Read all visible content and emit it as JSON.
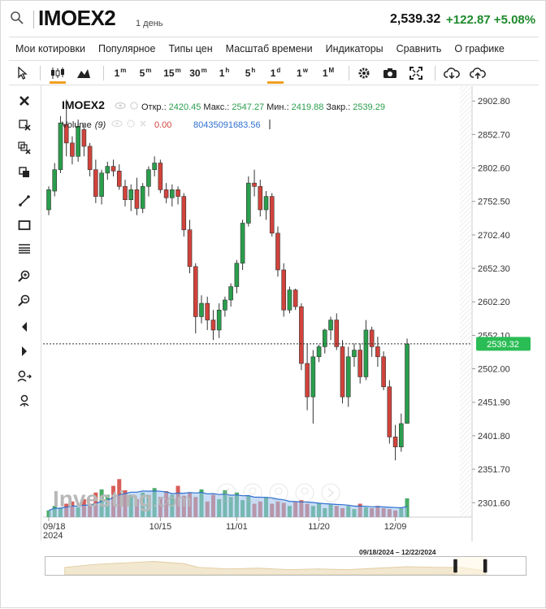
{
  "header": {
    "symbol": "IMOEX2",
    "interval": "1 день",
    "price": "2,539.32",
    "change": "+122.87 +5.08%"
  },
  "menu": [
    "Мои котировки",
    "Популярное",
    "Типы цен",
    "Масштаб времени",
    "Индикаторы",
    "Сравнить",
    "О графике"
  ],
  "toolbar": {
    "timeframes": [
      {
        "n": "1",
        "u": "m"
      },
      {
        "n": "5",
        "u": "m"
      },
      {
        "n": "15",
        "u": "m"
      },
      {
        "n": "30",
        "u": "m"
      },
      {
        "n": "1",
        "u": "h"
      },
      {
        "n": "5",
        "u": "h"
      },
      {
        "n": "1",
        "u": "d"
      },
      {
        "n": "1",
        "u": "w"
      },
      {
        "n": "1",
        "u": "M"
      }
    ],
    "active_timeframe": "1d"
  },
  "legend": {
    "symbol": "IMOEX2",
    "open_label": "Откр.:",
    "open": "2420.45",
    "high_label": "Макс.:",
    "high": "2547.27",
    "low_label": "Мин.:",
    "low": "2419.88",
    "close_label": "Закр.:",
    "close": "2539.29",
    "volume_label": "Volume",
    "volume_param": "(9)",
    "volume_value": "0.00",
    "volume_ma": "80435091683.56"
  },
  "watermark": {
    "brand": "Investing",
    "suffix": ".com"
  },
  "colors": {
    "up": "#2a9e4c",
    "down": "#d1433b",
    "volume_ma": "#2f6fcf",
    "last_price_bg": "#2bbd55"
  },
  "chart_data": {
    "type": "candlestick",
    "y_ticks": [
      "2902.80",
      "2852.70",
      "2802.60",
      "2752.50",
      "2702.40",
      "2652.30",
      "2602.20",
      "2552.10",
      "2502.00",
      "2451.90",
      "2401.80",
      "2351.70",
      "2301.60"
    ],
    "ylim": [
      2280,
      2925
    ],
    "x_ticks": [
      {
        "label": "09/18",
        "sub": "2024",
        "index": 0
      },
      {
        "label": "10/15",
        "sub": "",
        "index": 19
      },
      {
        "label": "11/01",
        "sub": "",
        "index": 32
      },
      {
        "label": "11/20",
        "sub": "",
        "index": 46
      },
      {
        "label": "12/09",
        "sub": "",
        "index": 59
      }
    ],
    "last_price": "2539.32",
    "last_value": 2539.32,
    "candles": [
      [
        2740,
        2775,
        2732,
        2770
      ],
      [
        2768,
        2810,
        2760,
        2800
      ],
      [
        2800,
        2880,
        2795,
        2870
      ],
      [
        2868,
        2905,
        2820,
        2840
      ],
      [
        2840,
        2850,
        2808,
        2820
      ],
      [
        2820,
        2875,
        2812,
        2865
      ],
      [
        2860,
        2868,
        2820,
        2835
      ],
      [
        2835,
        2840,
        2790,
        2800
      ],
      [
        2800,
        2815,
        2750,
        2760
      ],
      [
        2760,
        2800,
        2748,
        2795
      ],
      [
        2795,
        2812,
        2785,
        2805
      ],
      [
        2805,
        2815,
        2790,
        2798
      ],
      [
        2798,
        2808,
        2770,
        2775
      ],
      [
        2775,
        2785,
        2745,
        2755
      ],
      [
        2755,
        2778,
        2738,
        2770
      ],
      [
        2770,
        2788,
        2732,
        2742
      ],
      [
        2742,
        2780,
        2735,
        2775
      ],
      [
        2775,
        2805,
        2760,
        2800
      ],
      [
        2800,
        2820,
        2790,
        2810
      ],
      [
        2810,
        2815,
        2765,
        2770
      ],
      [
        2770,
        2780,
        2750,
        2758
      ],
      [
        2758,
        2778,
        2745,
        2770
      ],
      [
        2770,
        2775,
        2748,
        2760
      ],
      [
        2760,
        2765,
        2700,
        2710
      ],
      [
        2710,
        2725,
        2645,
        2655
      ],
      [
        2655,
        2660,
        2555,
        2580
      ],
      [
        2580,
        2612,
        2570,
        2600
      ],
      [
        2600,
        2610,
        2560,
        2575
      ],
      [
        2575,
        2590,
        2545,
        2560
      ],
      [
        2560,
        2600,
        2548,
        2590
      ],
      [
        2590,
        2610,
        2580,
        2605
      ],
      [
        2605,
        2630,
        2595,
        2625
      ],
      [
        2625,
        2665,
        2615,
        2660
      ],
      [
        2660,
        2725,
        2650,
        2720
      ],
      [
        2720,
        2790,
        2715,
        2780
      ],
      [
        2780,
        2800,
        2760,
        2775
      ],
      [
        2775,
        2785,
        2730,
        2740
      ],
      [
        2740,
        2768,
        2725,
        2760
      ],
      [
        2760,
        2765,
        2700,
        2705
      ],
      [
        2705,
        2715,
        2640,
        2650
      ],
      [
        2650,
        2660,
        2580,
        2590
      ],
      [
        2590,
        2625,
        2585,
        2620
      ],
      [
        2620,
        2622,
        2590,
        2595
      ],
      [
        2595,
        2600,
        2500,
        2510
      ],
      [
        2510,
        2540,
        2440,
        2460
      ],
      [
        2460,
        2530,
        2420,
        2520
      ],
      [
        2520,
        2538,
        2512,
        2535
      ],
      [
        2535,
        2562,
        2525,
        2560
      ],
      [
        2560,
        2580,
        2545,
        2575
      ],
      [
        2575,
        2585,
        2530,
        2535
      ],
      [
        2535,
        2545,
        2450,
        2460
      ],
      [
        2460,
        2535,
        2445,
        2520
      ],
      [
        2520,
        2540,
        2505,
        2530
      ],
      [
        2530,
        2540,
        2480,
        2490
      ],
      [
        2490,
        2575,
        2485,
        2560
      ],
      [
        2560,
        2565,
        2520,
        2535
      ],
      [
        2535,
        2550,
        2505,
        2520
      ],
      [
        2520,
        2528,
        2470,
        2475
      ],
      [
        2475,
        2485,
        2390,
        2400
      ],
      [
        2400,
        2418,
        2365,
        2385
      ],
      [
        2385,
        2435,
        2378,
        2420
      ],
      [
        2420.45,
        2547.27,
        2419.88,
        2539.29
      ]
    ],
    "volumes": [
      0.15,
      0.25,
      0.2,
      0.3,
      0.35,
      0.22,
      0.4,
      0.3,
      0.55,
      0.62,
      0.5,
      0.7,
      0.85,
      0.6,
      0.5,
      0.4,
      0.55,
      0.5,
      0.65,
      0.45,
      0.58,
      0.5,
      0.7,
      0.48,
      0.55,
      0.45,
      0.62,
      0.35,
      0.5,
      0.4,
      0.6,
      0.45,
      0.55,
      0.38,
      0.48,
      0.3,
      0.35,
      0.45,
      0.3,
      0.35,
      0.32,
      0.25,
      0.35,
      0.38,
      0.3,
      0.25,
      0.3,
      0.2,
      0.28,
      0.25,
      0.2,
      0.25,
      0.18,
      0.3,
      0.22,
      0.2,
      0.25,
      0.2,
      0.18,
      0.15,
      0.2,
      0.42
    ]
  },
  "navigator": {
    "range_label": "09/18/2024 – 12/22/2024"
  }
}
